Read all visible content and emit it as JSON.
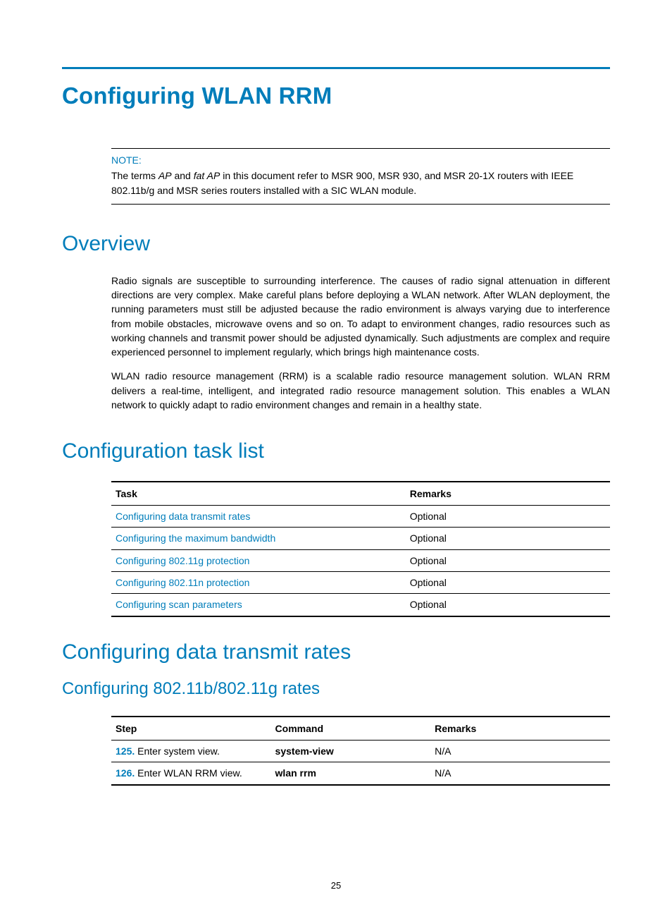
{
  "title": "Configuring WLAN RRM",
  "note": {
    "label": "NOTE:",
    "prefix": "The terms ",
    "italic1": "AP",
    "middle": " and ",
    "italic2": "fat AP",
    "suffix": " in this document refer to MSR 900, MSR 930, and MSR 20-1X routers with IEEE 802.11b/g and MSR series routers installed with a SIC WLAN module."
  },
  "overview": {
    "heading": "Overview",
    "para1": "Radio signals are susceptible to surrounding interference. The causes of radio signal attenuation in different directions are very complex. Make careful plans before deploying a WLAN network. After WLAN deployment, the running parameters must still be adjusted because the radio environment is always varying due to interference from mobile obstacles, microwave ovens and so on. To adapt to environment changes, radio resources such as working channels and transmit power should be adjusted dynamically. Such adjustments are complex and require experienced personnel to implement regularly, which brings high maintenance costs.",
    "para2": "WLAN radio resource management (RRM) is a scalable radio resource management solution. WLAN RRM delivers a real-time, intelligent, and integrated radio resource management solution. This enables a WLAN network to quickly adapt to radio environment changes and remain in a healthy state."
  },
  "tasklist": {
    "heading": "Configuration task list",
    "headers": {
      "task": "Task",
      "remarks": "Remarks"
    },
    "rows": [
      {
        "task": "Configuring data transmit rates",
        "remarks": "Optional"
      },
      {
        "task": "Configuring the maximum bandwidth",
        "remarks": "Optional"
      },
      {
        "task": "Configuring 802.11g protection",
        "remarks": "Optional"
      },
      {
        "task": "Configuring 802.11n protection",
        "remarks": "Optional"
      },
      {
        "task": "Configuring scan parameters",
        "remarks": "Optional"
      }
    ]
  },
  "rates": {
    "heading": "Configuring data transmit rates",
    "subheading": "Configuring 802.11b/802.11g rates",
    "headers": {
      "step": "Step",
      "command": "Command",
      "remarks": "Remarks"
    },
    "rows": [
      {
        "num": "125.",
        "desc": " Enter system view.",
        "command": "system-view",
        "remarks": "N/A"
      },
      {
        "num": "126.",
        "desc": " Enter WLAN RRM view.",
        "command": "wlan rrm",
        "remarks": "N/A"
      }
    ]
  },
  "page_number": "25"
}
